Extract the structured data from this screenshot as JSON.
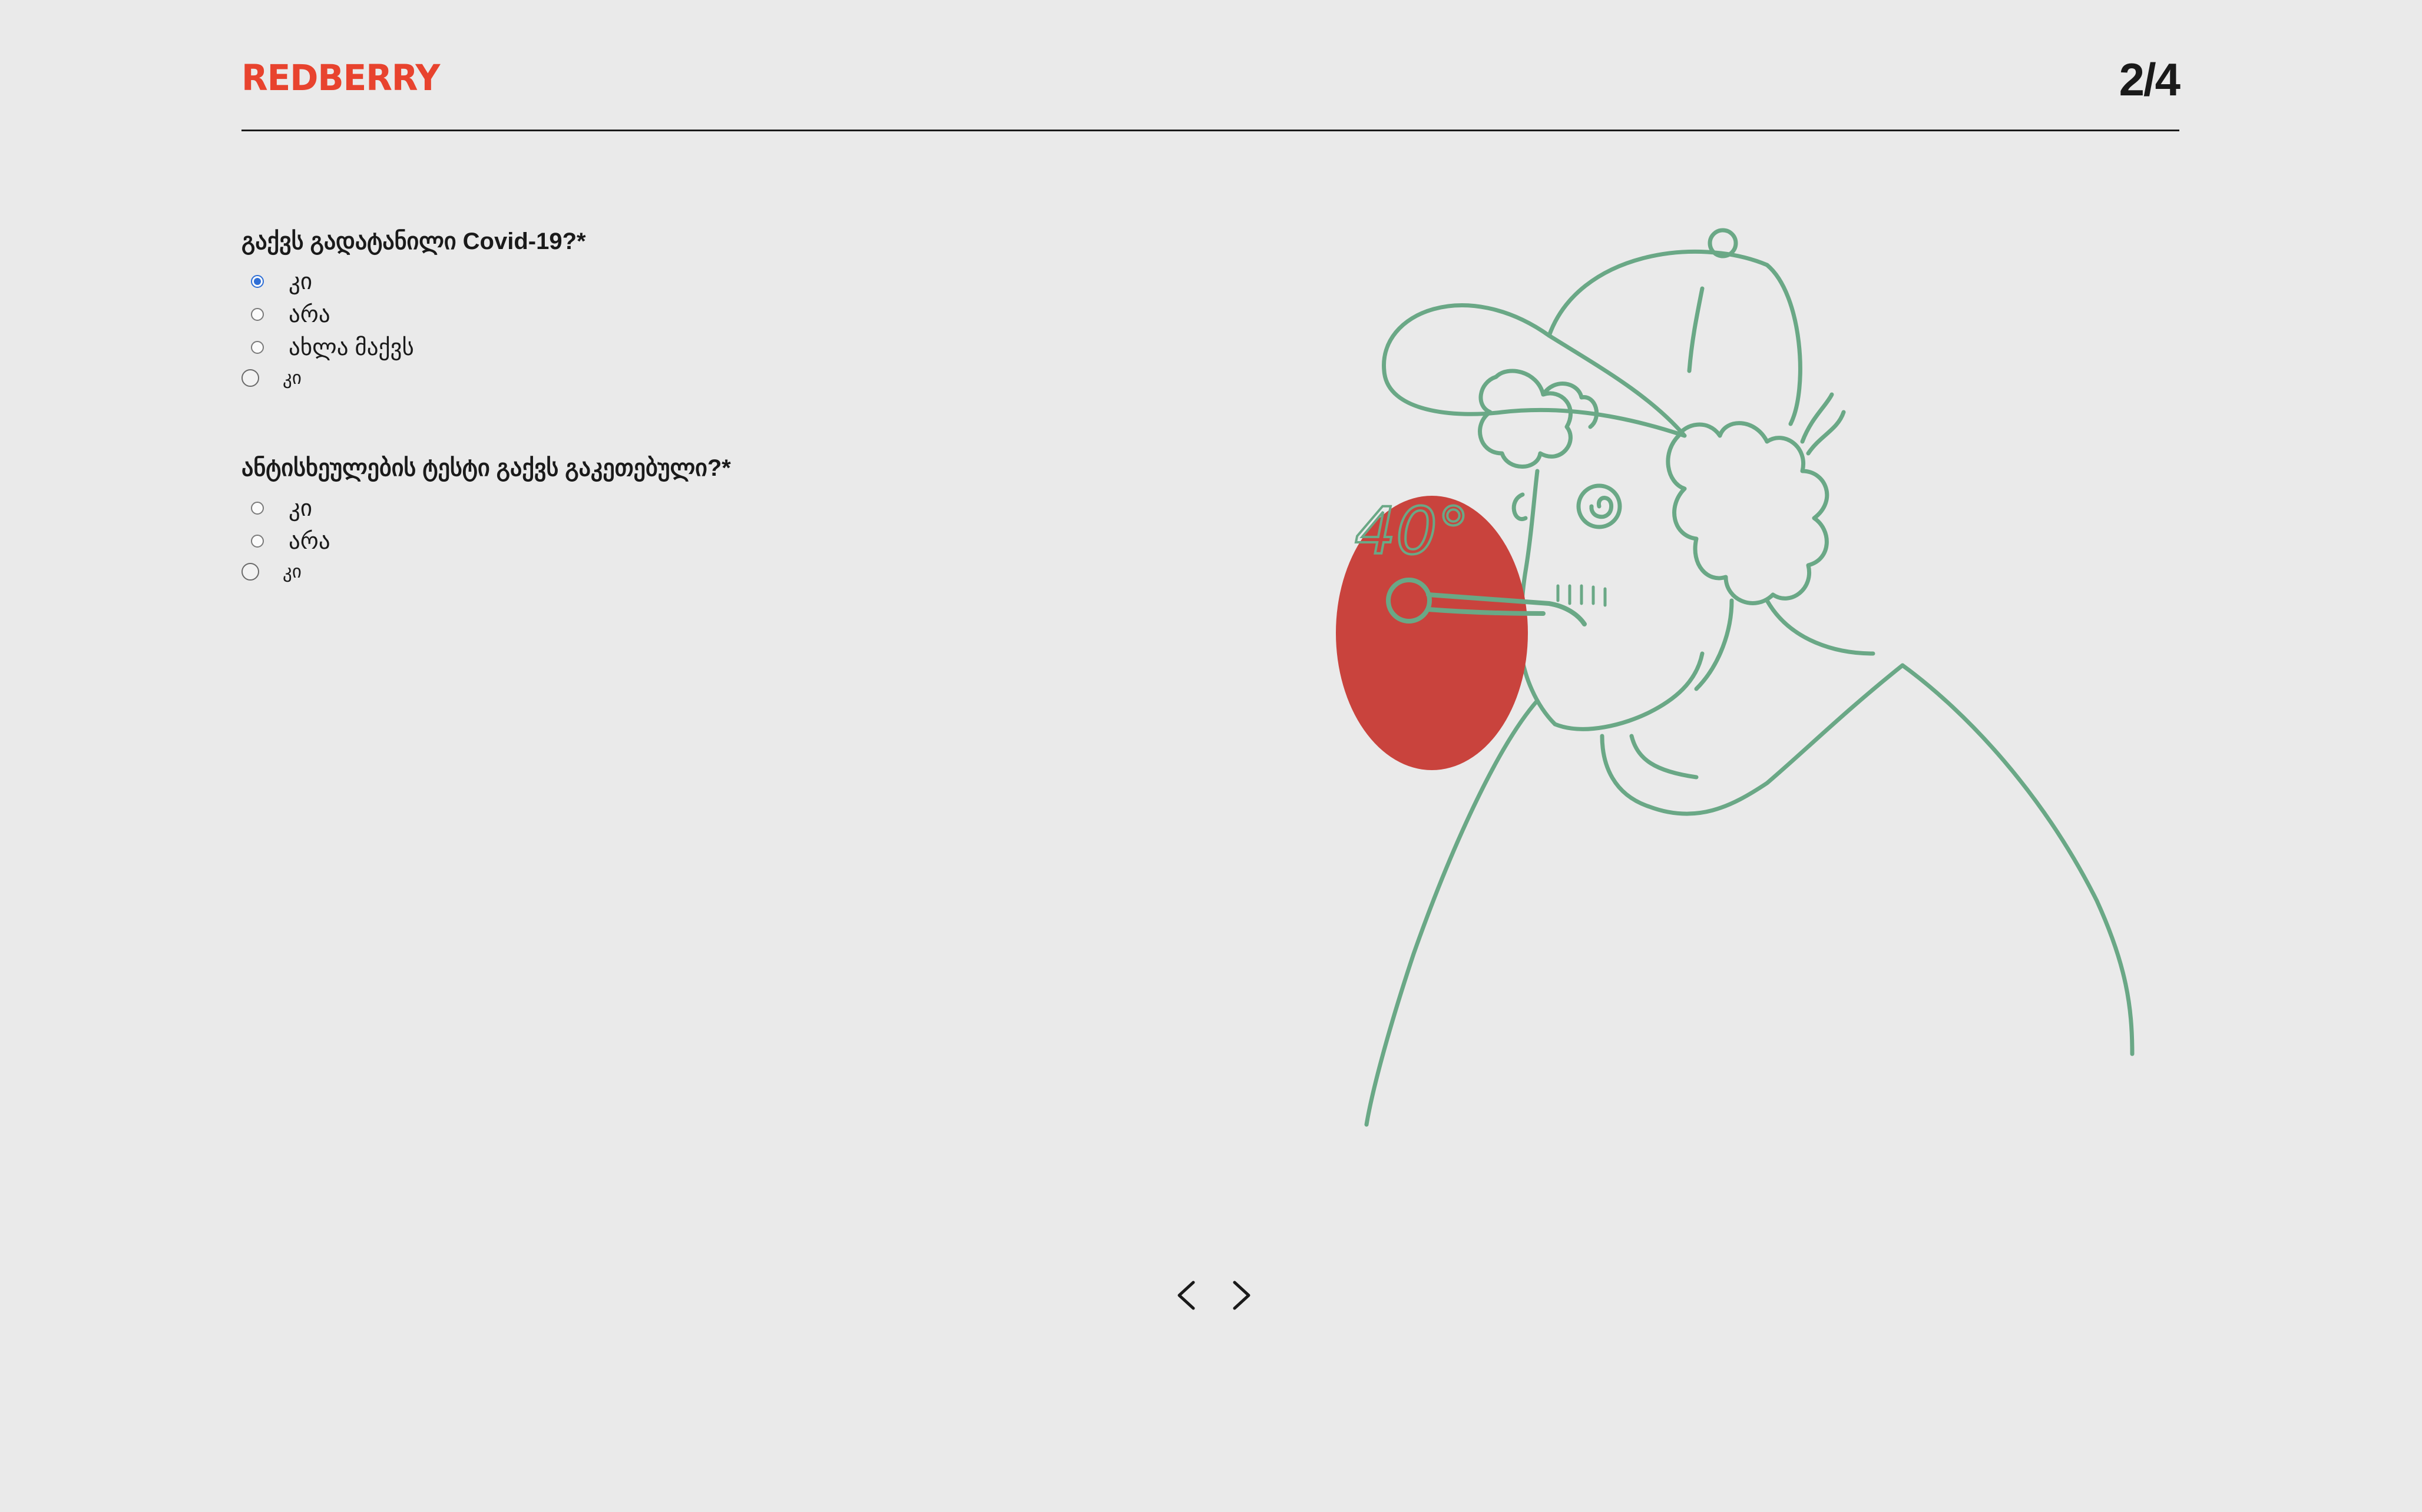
{
  "brand": {
    "logo_text": "REDBERRY",
    "color": "#e8432e"
  },
  "progress": {
    "label": "2/4",
    "current": 2,
    "total": 4
  },
  "questions": [
    {
      "title": "გაქვს გადატანილი Covid-19?*",
      "options": [
        {
          "label": "კი",
          "checked": true
        },
        {
          "label": "არა",
          "checked": false
        },
        {
          "label": "ახლა მაქვს",
          "checked": false
        },
        {
          "label": "კი",
          "checked": false
        }
      ]
    },
    {
      "title": "ანტისხეულების ტესტი გაქვს გაკეთებული?*",
      "options": [
        {
          "label": "კი",
          "checked": false
        },
        {
          "label": "არა",
          "checked": false
        },
        {
          "label": "კი",
          "checked": false
        }
      ]
    }
  ],
  "illustration": {
    "subject": "person-with-thermometer",
    "thermometer_text": "40°",
    "line_color": "#6aa886",
    "accent_color": "#c9433d"
  },
  "navigation": {
    "prev_icon": "chevron-left-icon",
    "next_icon": "chevron-right-icon"
  }
}
